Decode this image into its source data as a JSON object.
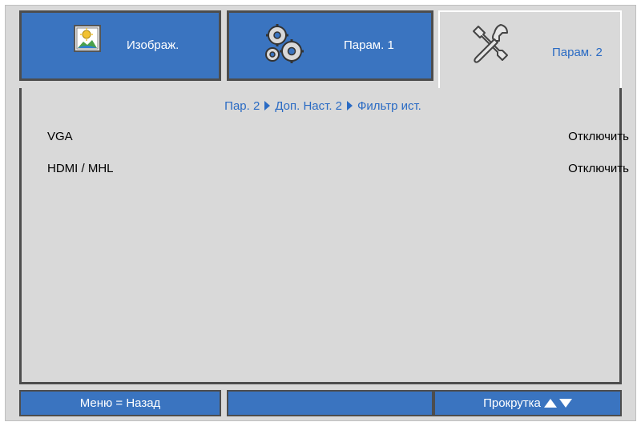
{
  "tabs": {
    "image": {
      "label": "Изображ.",
      "icon": "image-settings-icon"
    },
    "setup1": {
      "label": "Парам. 1",
      "icon": "gears-icon"
    },
    "setup2": {
      "label": "Парам. 2",
      "icon": "tools-icon"
    }
  },
  "breadcrumb": {
    "part1": "Пар. 2",
    "part2": "Доп. Наст. 2",
    "part3": "Фильтр ист."
  },
  "settings": [
    {
      "name": "VGA",
      "value": "Отключить"
    },
    {
      "name": "HDMI / MHL",
      "value": "Отключить"
    }
  ],
  "footer": {
    "back_label": "Меню = Назад",
    "middle_label": "",
    "scroll_label": "Прокрутка"
  },
  "colors": {
    "tab_blue": "#3a74c0",
    "text_blue": "#2a6bc4",
    "panel_gray": "#d9d9d9"
  }
}
